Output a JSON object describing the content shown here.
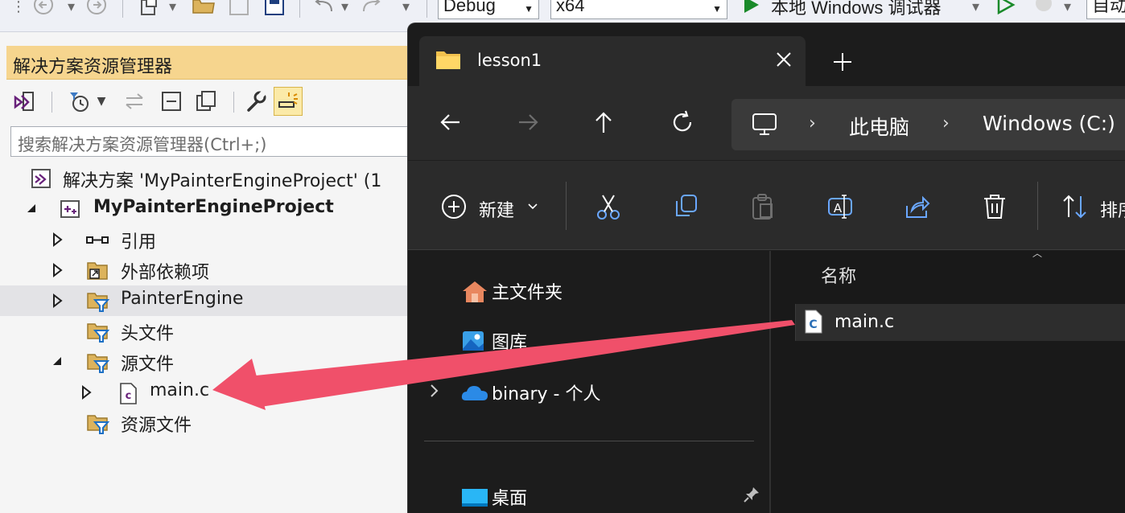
{
  "toolbar": {
    "config": "Debug",
    "platform": "x64",
    "debugger": "本地 Windows 调试器",
    "partial_right": "自动"
  },
  "solution_explorer": {
    "title": "解决方案资源管理器",
    "search_placeholder": "搜索解决方案资源管理器(Ctrl+;)",
    "tree": [
      {
        "label": "解决方案 'MyPainterEngineProject' (1"
      },
      {
        "label": "MyPainterEngineProject"
      },
      {
        "label": "引用"
      },
      {
        "label": "外部依赖项"
      },
      {
        "label": "PainterEngine"
      },
      {
        "label": "头文件"
      },
      {
        "label": "源文件"
      },
      {
        "label": "main.c"
      },
      {
        "label": "资源文件"
      }
    ]
  },
  "file_explorer": {
    "tab_title": "lesson1",
    "breadcrumb": [
      "此电脑",
      "Windows (C:)"
    ],
    "commands": {
      "new": "新建",
      "sort": "排序"
    },
    "nav": [
      {
        "label": "主文件夹"
      },
      {
        "label": "图库"
      },
      {
        "label": "binary - 个人"
      },
      {
        "label": "桌面"
      }
    ],
    "column_name": "名称",
    "files": [
      {
        "name": "main.c"
      }
    ]
  },
  "colors": {
    "se_title_bg": "#f6d58e",
    "explorer_bg": "#1c1c1c",
    "arrow": "#f0506a",
    "vs_purple": "#68217a"
  }
}
